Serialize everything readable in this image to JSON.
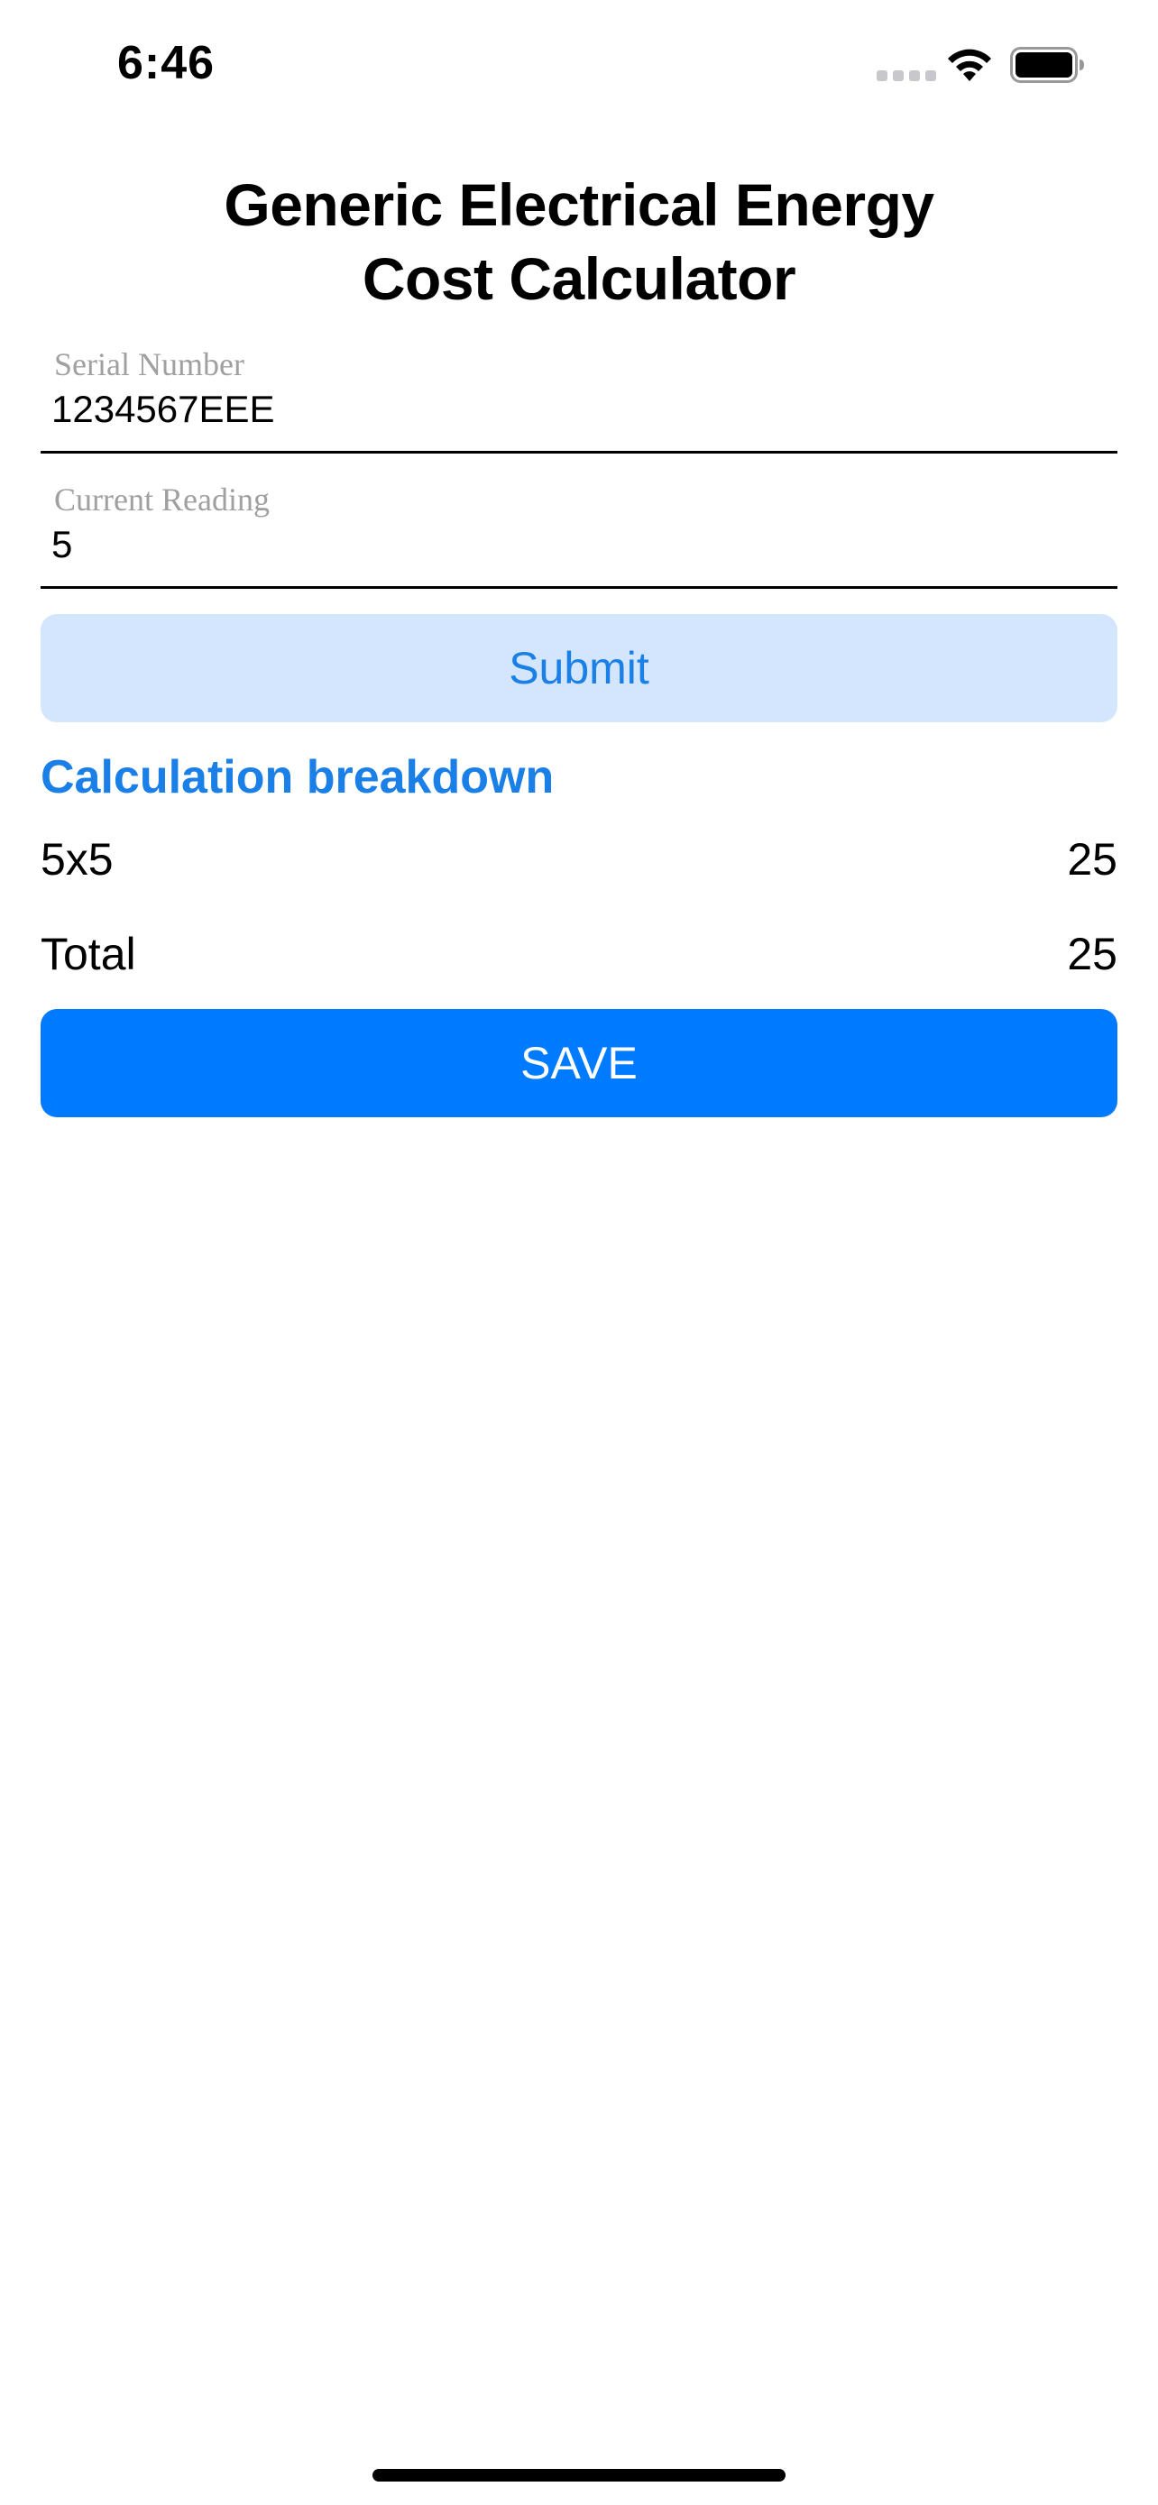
{
  "status_bar": {
    "time": "6:46"
  },
  "title": {
    "line1": "Generic Electrical Energy",
    "line2": "Cost Calculator"
  },
  "fields": {
    "serial": {
      "label": "Serial Number",
      "value": "1234567EEE"
    },
    "reading": {
      "label": "Current Reading",
      "value": "5"
    }
  },
  "buttons": {
    "submit_label": "Submit",
    "save_label": "SAVE"
  },
  "breakdown": {
    "heading": "Calculation breakdown",
    "rows": [
      {
        "label": "5x5",
        "value": "25"
      },
      {
        "label": "Total",
        "value": "25"
      }
    ]
  },
  "colors": {
    "accent": "#007aff",
    "accent_text": "#1a7fe6",
    "submit_bg": "#d3e6fd",
    "label_gray": "#a0a0a0"
  },
  "icons": {
    "signal": "cellular-signal-icon",
    "wifi": "wifi-icon",
    "battery": "battery-icon"
  }
}
